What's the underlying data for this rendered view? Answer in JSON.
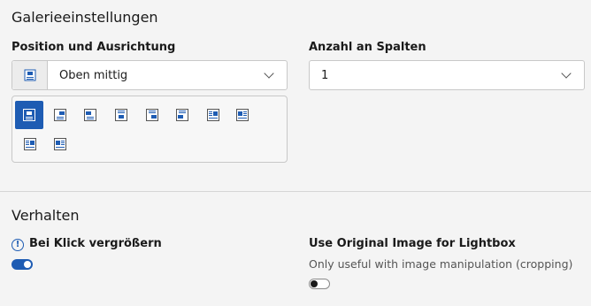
{
  "gallery": {
    "title": "Galerieeinstellungen",
    "position_label": "Position und Ausrichtung",
    "position_value": "Oben mittig",
    "position_options": [
      {
        "icon": "top-center-icon",
        "active": true
      },
      {
        "icon": "top-right-icon",
        "active": false
      },
      {
        "icon": "top-left-icon",
        "active": false
      },
      {
        "icon": "bottom-center-icon",
        "active": false
      },
      {
        "icon": "bottom-right-icon",
        "active": false
      },
      {
        "icon": "bottom-left-icon",
        "active": false
      },
      {
        "icon": "intext-right-icon",
        "active": false
      },
      {
        "icon": "intext-left-icon",
        "active": false
      },
      {
        "icon": "intext-right-nowrap-icon",
        "active": false
      },
      {
        "icon": "intext-left-nowrap-icon",
        "active": false
      }
    ],
    "columns_label": "Anzahl an Spalten",
    "columns_value": "1"
  },
  "behavior": {
    "title": "Verhalten",
    "zoom_label": "Bei Klick vergrößern",
    "zoom_info_icon": "info-icon",
    "zoom_on": true,
    "lightbox_label": "Use Original Image for Lightbox",
    "lightbox_description": "Only useful with image manipulation (cropping)",
    "lightbox_on": false
  },
  "colors": {
    "accent": "#1e5cb3",
    "background": "#f4f4f4"
  }
}
